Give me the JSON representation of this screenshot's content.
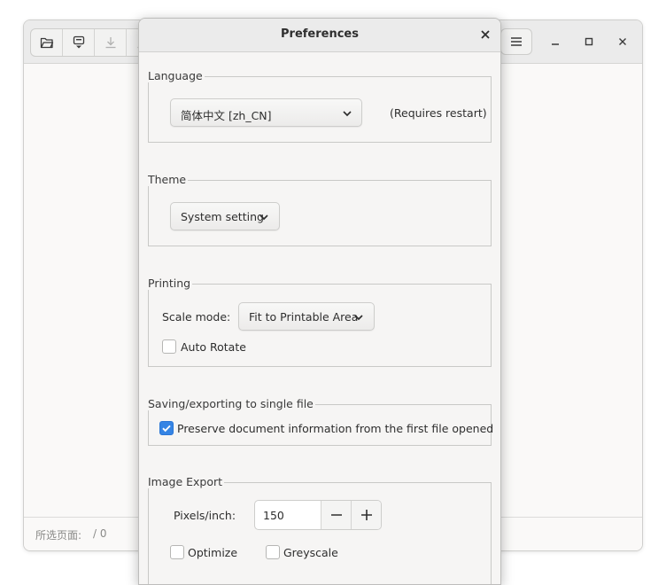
{
  "main_window": {
    "toolbar": {
      "icons": [
        "folder-open-icon",
        "save-icon",
        "download-icon",
        "download-icon"
      ],
      "menu_icon": "hamburger-menu-icon"
    },
    "window_controls": [
      "minimize-icon",
      "maximize-icon",
      "close-icon"
    ],
    "statusbar": {
      "selected_pages_label": "所选页面:",
      "selected_pages_count": "/ 0"
    }
  },
  "dialog": {
    "title": "Preferences",
    "language": {
      "label": "Language",
      "value": "简体中文 [zh_CN]",
      "note": "(Requires restart)"
    },
    "theme": {
      "label": "Theme",
      "value": "System setting"
    },
    "printing": {
      "label": "Printing",
      "scale_mode_label": "Scale mode:",
      "scale_mode_value": "Fit to Printable Area",
      "auto_rotate_label": "Auto Rotate",
      "auto_rotate_checked": false
    },
    "saving": {
      "label": "Saving/exporting to single file",
      "preserve_label": "Preserve document information from the first file opened",
      "preserve_checked": true
    },
    "image_export": {
      "label": "Image Export",
      "ppi_label": "Pixels/inch:",
      "ppi_value": "150",
      "optimize_label": "Optimize",
      "optimize_checked": false,
      "greyscale_label": "Greyscale",
      "greyscale_checked": false
    }
  },
  "colors": {
    "accent": "#3584e4",
    "dialog_bg": "#f6f5f4",
    "header_bg": "#ebebeb"
  }
}
